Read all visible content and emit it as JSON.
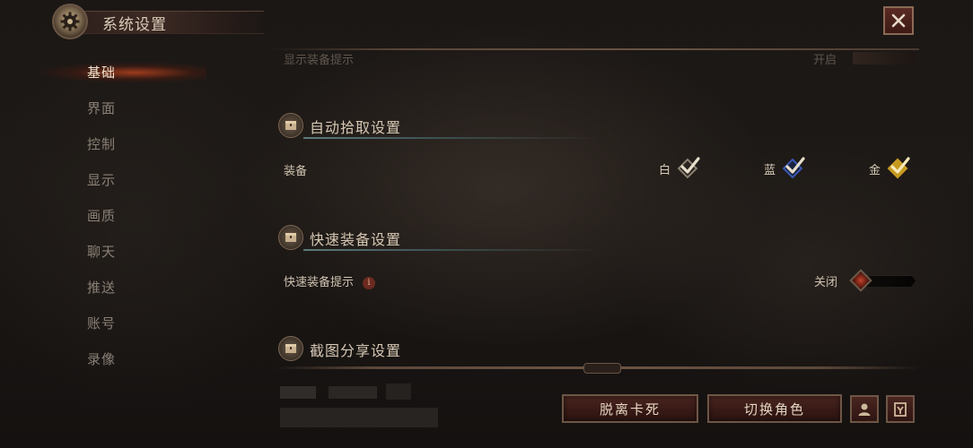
{
  "header": {
    "title": "系统设置",
    "settings_icon": "gear-icon",
    "close_icon": "close-icon"
  },
  "sidebar": {
    "items": [
      {
        "label": "基础",
        "active": true
      },
      {
        "label": "界面",
        "active": false
      },
      {
        "label": "控制",
        "active": false
      },
      {
        "label": "显示",
        "active": false
      },
      {
        "label": "画质",
        "active": false
      },
      {
        "label": "聊天",
        "active": false
      },
      {
        "label": "推送",
        "active": false
      },
      {
        "label": "账号",
        "active": false
      },
      {
        "label": "录像",
        "active": false
      }
    ]
  },
  "main": {
    "partial_row": {
      "label": "显示装备提示",
      "value": "开启"
    },
    "auto_pickup": {
      "title": "自动拾取设置",
      "icon": "chest-icon",
      "row_label": "装备",
      "options": [
        {
          "label": "白",
          "checked": true,
          "color": "#d8d2c4"
        },
        {
          "label": "蓝",
          "checked": true,
          "color": "#3e63c8"
        },
        {
          "label": "金",
          "checked": true,
          "color": "#e2b62a"
        }
      ]
    },
    "quick_equip": {
      "title": "快速装备设置",
      "icon": "chest-icon",
      "row_label": "快速装备提示",
      "info_icon": "i",
      "state": "关闭",
      "enabled": false
    },
    "screenshot_share": {
      "title": "截图分享设置",
      "icon": "chest-icon"
    }
  },
  "footer": {
    "unstuck_label": "脱离卡死",
    "switch_character_label": "切换角色",
    "profile_icon": "person-icon",
    "codex_icon": "book-icon"
  },
  "colors": {
    "accent_red": "#c2442c",
    "gold_text": "#d9cbb8",
    "nav_active_glow": "#c8461e"
  }
}
